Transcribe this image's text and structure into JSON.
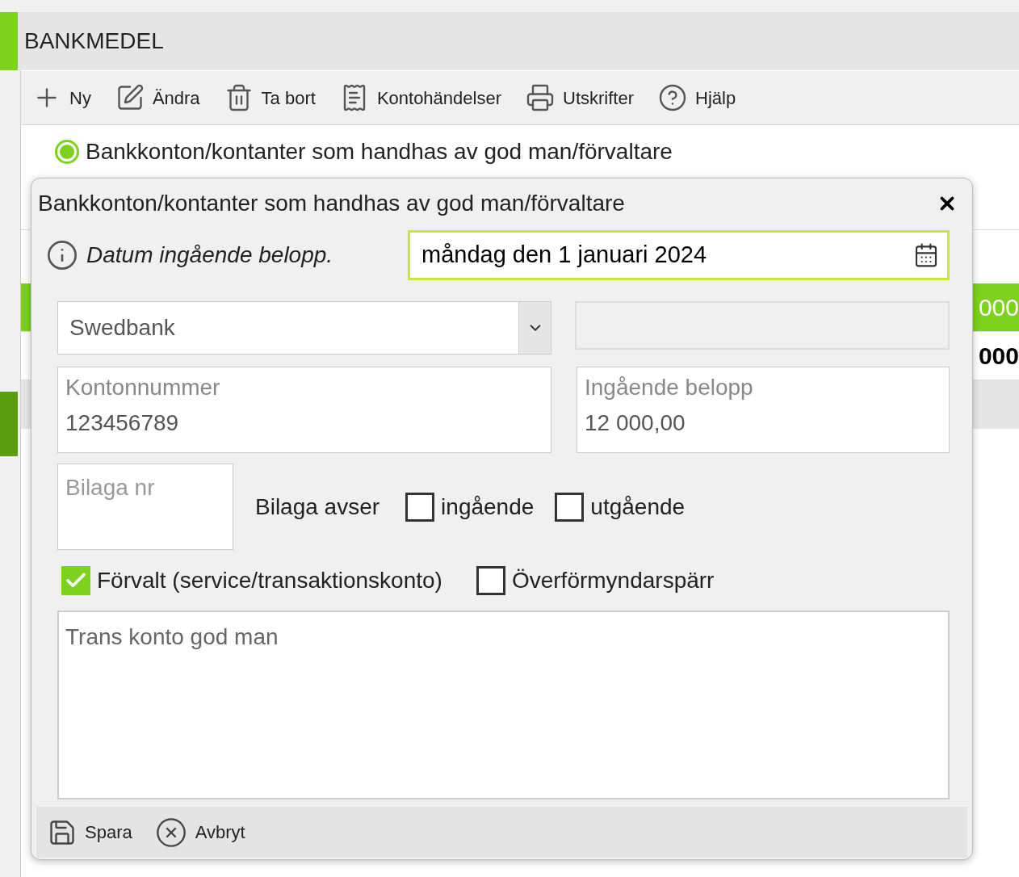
{
  "header": {
    "title": "BANKMEDEL"
  },
  "toolbar": [
    {
      "label": "Ny",
      "kind": "new"
    },
    {
      "label": "Ändra",
      "kind": "edit"
    },
    {
      "label": "Ta bort",
      "kind": "delete"
    },
    {
      "label": "Kontohändelser",
      "kind": "ledger"
    },
    {
      "label": "Utskrifter",
      "kind": "print"
    },
    {
      "label": "Hjälp",
      "kind": "help"
    }
  ],
  "section": {
    "title": "Bankkonton/kontanter som handhas av god man/förvaltare"
  },
  "list": {
    "rows": [
      {
        "value": "000",
        "selected": true,
        "kind": "row"
      },
      {
        "value": "000",
        "selected": false,
        "kind": "total"
      }
    ]
  },
  "dialog": {
    "title": "Bankkonton/kontanter som handhas av god man/förvaltare",
    "date_label": "Datum ingående belopp.",
    "date_value": "måndag den 1 januari 2024",
    "bank": {
      "value": "Swedbank"
    },
    "fields": [
      {
        "label": "Kontonnummer",
        "value": "123456789"
      },
      {
        "label": "Ingående belopp",
        "value": "12 000,00"
      }
    ],
    "attachment": {
      "placeholder": "Bilaga nr"
    },
    "attachment_for": {
      "label": "Bilaga avser",
      "options": [
        {
          "label": "ingående",
          "checked": false
        },
        {
          "label": "utgående",
          "checked": false
        }
      ]
    },
    "options": [
      {
        "label": "Förvalt (service/transaktionskonto)",
        "checked": true
      },
      {
        "label": "Överförmyndarspärr",
        "checked": false
      }
    ],
    "notes": {
      "value": "Trans konto god man"
    },
    "footer": [
      {
        "label": "Spara",
        "kind": "save"
      },
      {
        "label": "Avbryt",
        "kind": "cancel"
      }
    ]
  }
}
